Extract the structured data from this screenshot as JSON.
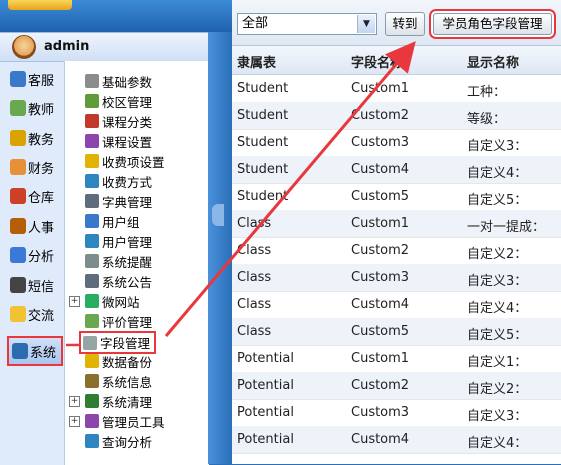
{
  "app": {
    "user": "admin"
  },
  "modules": [
    {
      "label": "客服",
      "color": "#3a78c9"
    },
    {
      "label": "教师",
      "color": "#6aa84f"
    },
    {
      "label": "教务",
      "color": "#d9a400"
    },
    {
      "label": "财务",
      "color": "#e69138"
    },
    {
      "label": "仓库",
      "color": "#cc4125"
    },
    {
      "label": "人事",
      "color": "#b45f06"
    },
    {
      "label": "分析",
      "color": "#3c78d8"
    },
    {
      "label": "短信",
      "color": "#444444"
    },
    {
      "label": "交流",
      "color": "#f1c232"
    },
    {
      "label": "系统",
      "color": "#2b6cb0"
    }
  ],
  "tree": [
    {
      "label": "基础参数",
      "icon": "gear-icon",
      "color": "#8c8c8c"
    },
    {
      "label": "校区管理",
      "icon": "campus-icon",
      "color": "#5e9c3a"
    },
    {
      "label": "课程分类",
      "icon": "book-stack-icon",
      "color": "#c0392b"
    },
    {
      "label": "课程设置",
      "icon": "book-icon",
      "color": "#8e44ad"
    },
    {
      "label": "收费项设置",
      "icon": "coins-icon",
      "color": "#e0b400"
    },
    {
      "label": "收费方式",
      "icon": "card-icon",
      "color": "#2e86c1"
    },
    {
      "label": "字典管理",
      "icon": "dictionary-icon",
      "color": "#5d6d7e"
    },
    {
      "label": "用户组",
      "icon": "users-icon",
      "color": "#3a78c9"
    },
    {
      "label": "用户管理",
      "icon": "user-icon",
      "color": "#2e86c1"
    },
    {
      "label": "系统提醒",
      "icon": "bell-icon",
      "color": "#7f8c8d"
    },
    {
      "label": "系统公告",
      "icon": "notice-icon",
      "color": "#5d6d7e"
    },
    {
      "label": "微网站",
      "icon": "globe-icon",
      "color": "#27ae60",
      "expandable": true
    },
    {
      "label": "评价管理",
      "icon": "rating-icon",
      "color": "#6aa84f"
    },
    {
      "label": "字段管理",
      "icon": "field-icon",
      "color": "#95a5a6",
      "highlight": true
    },
    {
      "label": "数据备份",
      "icon": "database-icon",
      "color": "#e0b400"
    },
    {
      "label": "系统信息",
      "icon": "info-icon",
      "color": "#8b6f2f"
    },
    {
      "label": "系统清理",
      "icon": "cleanup-icon",
      "color": "#2e7d32",
      "expandable": true
    },
    {
      "label": "管理员工具",
      "icon": "admin-tool-icon",
      "color": "#8e44ad",
      "expandable": true
    },
    {
      "label": "查询分析",
      "icon": "query-icon",
      "color": "#2e86c1"
    }
  ],
  "toolbar": {
    "select_value": "全部",
    "goto_label": "转到",
    "manage_label": "学员角色字段管理"
  },
  "table": {
    "headers": [
      "隶属表",
      "字段名称",
      "显示名称"
    ],
    "rows": [
      [
        "Student",
        "Custom1",
        "工种："
      ],
      [
        "Student",
        "Custom2",
        "等级："
      ],
      [
        "Student",
        "Custom3",
        "自定义3："
      ],
      [
        "Student",
        "Custom4",
        "自定义4："
      ],
      [
        "Student",
        "Custom5",
        "自定义5："
      ],
      [
        "Class",
        "Custom1",
        "一对一提成："
      ],
      [
        "Class",
        "Custom2",
        "自定义2："
      ],
      [
        "Class",
        "Custom3",
        "自定义3："
      ],
      [
        "Class",
        "Custom4",
        "自定义4："
      ],
      [
        "Class",
        "Custom5",
        "自定义5："
      ],
      [
        "Potential",
        "Custom1",
        "自定义1："
      ],
      [
        "Potential",
        "Custom2",
        "自定义2："
      ],
      [
        "Potential",
        "Custom3",
        "自定义3："
      ],
      [
        "Potential",
        "Custom4",
        "自定义4："
      ]
    ]
  },
  "colors": {
    "highlight": "#e8383d",
    "header_bg": "#dde7f3",
    "alt_row": "#eef3fa"
  }
}
